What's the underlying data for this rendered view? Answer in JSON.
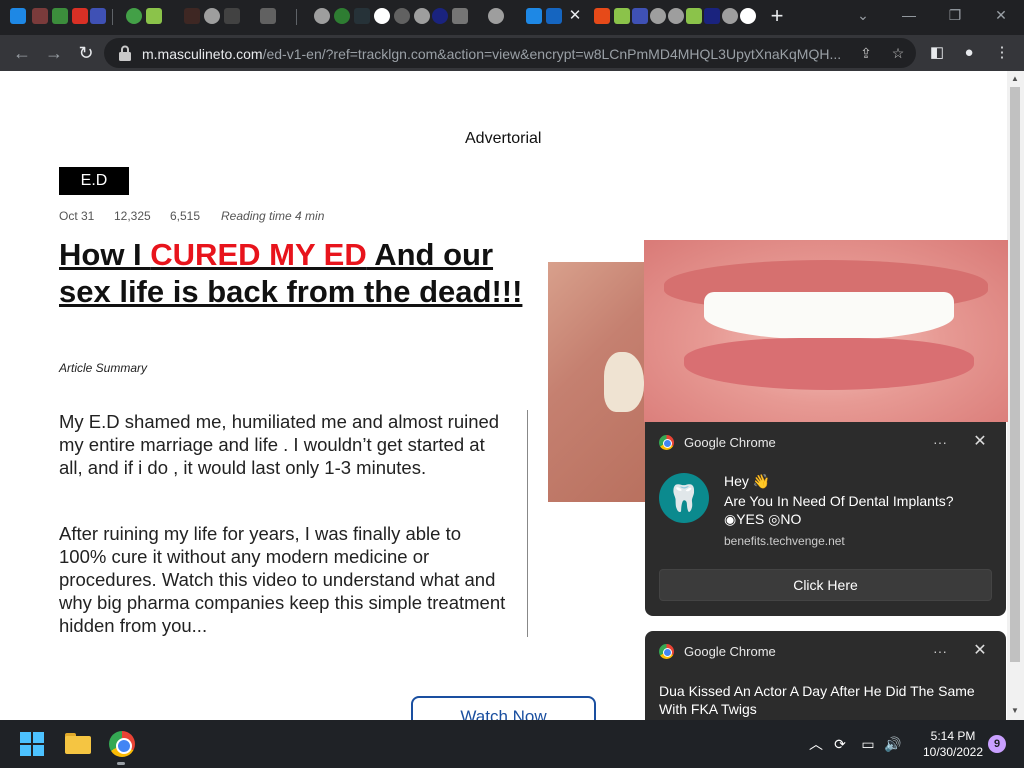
{
  "browser": {
    "url_host": "m.masculineto.com",
    "url_path": "/ed-v1-en/?ref=tracklgn.com&action=view&encrypt=w8LCnPmMD4MHQL3UpytXnaKqMQH...",
    "new_tab_label": "+",
    "tab_close_label": "✕"
  },
  "article": {
    "advertorial_label": "Advertorial",
    "category_badge": "E.D",
    "date": "Oct 31",
    "views": "12,325",
    "shares": "6,515",
    "reading_time": "Reading time 4 min",
    "headline_part1": "How I ",
    "headline_red": "CURED MY ED",
    "headline_part2": " And our sex life is back from the dead!!!",
    "summary_label": "Article Summary",
    "paragraph1": "My E.D shamed me, humiliated me and almost ruined my entire marriage and life . I wouldn’t get started at all, and if i do , it would last only 1-3 minutes.",
    "paragraph2": "After ruining my life for years, I was finally able to 100% cure it without any modern medicine or procedures. Watch this video to understand what and why big pharma companies keep this simple treatment hidden from you...",
    "watch_button": "Watch Now"
  },
  "notifications": [
    {
      "app": "Google Chrome",
      "title": "Hey 👋",
      "body": "Are You In Need Of Dental Implants? ◉YES ◎NO",
      "source": "benefits.techvenge.net",
      "action": "Click Here"
    },
    {
      "app": "Google Chrome",
      "body": "Dua Kissed An Actor A Day After He Did The Same With FKA Twigs"
    }
  ],
  "taskbar": {
    "time": "5:14 PM",
    "date": "10/30/2022",
    "notification_count": "9"
  },
  "icons": {
    "back": "arrow-left-icon",
    "forward": "arrow-right-icon",
    "reload": "reload-icon",
    "share": "share-icon",
    "bookmark": "star-icon",
    "side_panel": "side-panel-icon",
    "profile": "profile-icon",
    "menu": "kebab-menu-icon"
  },
  "colors": {
    "headline_red": "#e8141c",
    "button_blue": "#1a4fa0",
    "notification_bg": "#2c2c2c",
    "browser_dark": "#202124"
  }
}
